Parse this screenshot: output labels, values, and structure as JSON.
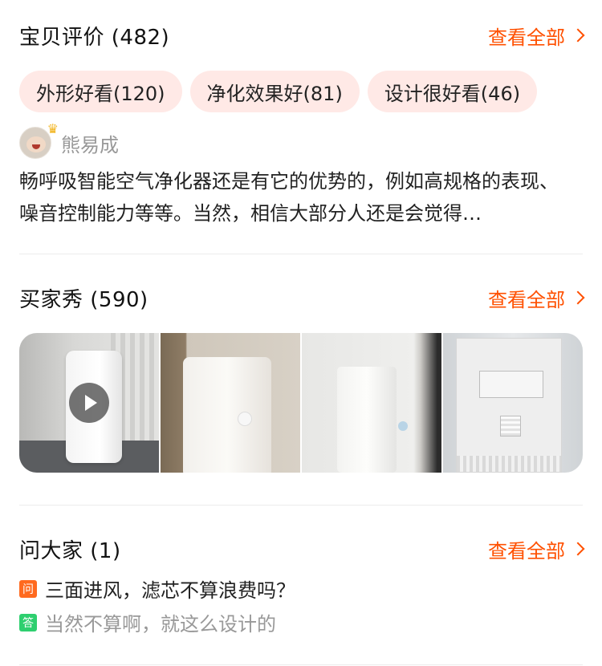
{
  "reviews": {
    "title": "宝贝评价 (482)",
    "view_all": "查看全部",
    "tags": [
      {
        "label": "外形好看(120)"
      },
      {
        "label": "净化效果好(81)"
      },
      {
        "label": "设计很好看(46)"
      }
    ],
    "reviewer": {
      "name": "熊易成",
      "avatar_icon": "avatar-crown-icon"
    },
    "text": "畅呼吸智能空气净化器还是有它的优势的，例如高规格的表现、噪音控制能力等等。当然，相信大部分人还是会觉得…"
  },
  "buyer_show": {
    "title": "买家秀 (590)",
    "view_all": "查看全部",
    "photos": [
      {
        "has_video": true,
        "icon": "play-icon"
      },
      {
        "has_video": false
      },
      {
        "has_video": false
      },
      {
        "has_video": false
      }
    ]
  },
  "ask": {
    "title": "问大家 (1)",
    "view_all": "查看全部",
    "question_badge": "问",
    "question": "三面进风，滤芯不算浪费吗？",
    "answer_badge": "答",
    "answer": "当然不算啊，就这么设计的"
  },
  "colors": {
    "accent": "#ff5000",
    "tag_bg": "#ffe9e6",
    "question_badge": "#ff6a1f",
    "answer_badge": "#2ecf6f",
    "muted_text": "#999999"
  }
}
